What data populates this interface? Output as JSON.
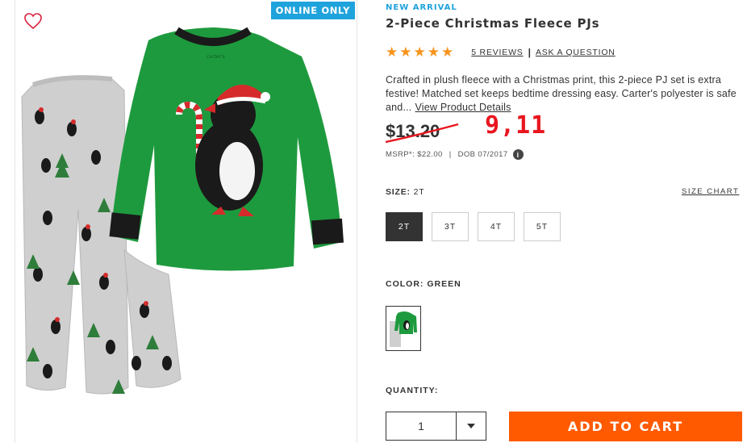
{
  "badge": "ONLINE ONLY",
  "product": {
    "new_arrival": "NEW ARRIVAL",
    "title": "2-Piece Christmas Fleece PJs",
    "rating": 5,
    "stars": "★★★★★",
    "reviews_link": "5 REVIEWS",
    "rating_separator": "|",
    "ask_link": "ASK A QUESTION",
    "description": "Crafted in plush fleece with a Christmas print, this 2-piece PJ set is extra festive! Matched set keeps bedtime dressing easy. Carter's polyester is safe and...",
    "view_details": "View Product Details",
    "price_old": "$13.20",
    "price_new": "9,11",
    "msrp": "MSRP*: $22.00",
    "msrp_separator": "|",
    "dob": "DOB 07/2017",
    "info_icon": "i",
    "shirt_tag": "carter's"
  },
  "size": {
    "label": "SIZE:",
    "value": "2T",
    "chart_link": "SIZE CHART",
    "options": [
      "2T",
      "3T",
      "4T",
      "5T"
    ],
    "selected": "2T"
  },
  "color": {
    "label": "COLOR: GREEN"
  },
  "quantity": {
    "label": "QUANTITY:",
    "value": "1"
  },
  "cart": {
    "button_label": "ADD TO CART"
  },
  "colors": {
    "accent_blue": "#1fa3dc",
    "star_orange": "#f7941d",
    "cart_orange": "#ff5a00",
    "price_red": "#e8161e",
    "shirt_green": "#1e9a3e"
  },
  "icons": {
    "wishlist": "heart-icon",
    "info": "info-icon",
    "dropdown": "chevron-down-icon"
  }
}
